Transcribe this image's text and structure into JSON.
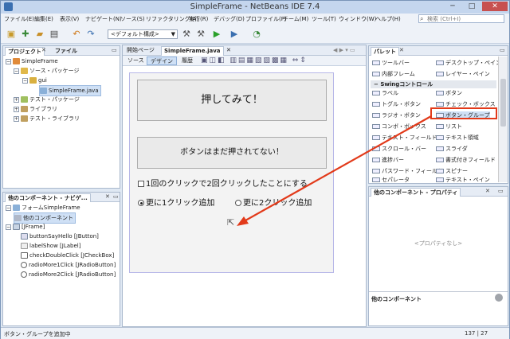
{
  "window": {
    "title": "SimpleFrame - NetBeans IDE 7.4"
  },
  "menu": [
    "ファイル(E)",
    "編集(E)",
    "表示(V)",
    "ナビゲート(N)",
    "ソース(S)",
    "リファクタリング(A)",
    "実行(R)",
    "デバッグ(D)",
    "プロファイル(P)",
    "チーム(M)",
    "ツール(T)",
    "ウィンドウ(W)",
    "ヘルプ(H)"
  ],
  "search": {
    "placeholder": "検索 (Ctrl+I)"
  },
  "toolbar": {
    "config": "<デフォルト構成>"
  },
  "project_panel": {
    "tabs": [
      "プロジェクト",
      "ファイル"
    ],
    "tree": [
      {
        "label": "SimpleFrame",
        "level": 0
      },
      {
        "label": "ソース・パッケージ",
        "level": 1
      },
      {
        "label": "gui",
        "level": 2
      },
      {
        "label": "SimpleFrame.java",
        "level": 3
      },
      {
        "label": "テスト・パッケージ",
        "level": 1
      },
      {
        "label": "ライブラリ",
        "level": 1
      },
      {
        "label": "テスト・ライブラリ",
        "level": 1
      }
    ]
  },
  "navigator_panel": {
    "title": "他のコンポーネント - ナビゲ...",
    "tree": [
      {
        "label": "フォームSimpleFrame",
        "level": 0
      },
      {
        "label": "他のコンポーネント",
        "level": 1
      },
      {
        "label": "[JFrame]",
        "level": 1
      },
      {
        "label": "buttonSayHello [JButton]",
        "level": 2
      },
      {
        "label": "labelShow [JLabel]",
        "level": 2
      },
      {
        "label": "checkDoubleClick [JCheckBox]",
        "level": 2
      },
      {
        "label": "radioMore1Click [JRadioButton]",
        "level": 2
      },
      {
        "label": "radioMore2Click [JRadioButton]",
        "level": 2
      }
    ]
  },
  "editor": {
    "tabs": [
      "開始ページ",
      "SimpleFrame.java"
    ],
    "subtabs": [
      "ソース",
      "デザイン",
      "履歴"
    ],
    "form": {
      "button_text": "押してみて！",
      "label_text": "ボタンはまだ押されてない！",
      "checkbox_text": "1回のクリックで2回クリックしたことにする",
      "radio1_text": "更に1クリック追加",
      "radio2_text": "更に2クリック追加"
    }
  },
  "palette": {
    "title": "パレット",
    "items_top": [
      "ツールバー",
      "デスクトップ・ペイン",
      "内部フレーム",
      "レイヤー・ペイン"
    ],
    "section": "Swingコントロール",
    "items": [
      "ラベル",
      "ボタン",
      "トグル・ボタン",
      "チェック・ボックス",
      "ラジオ・ボタン",
      "ボタン・グループ",
      "コンボ・ボックス",
      "リスト",
      "テキスト・フィールド",
      "テキスト領域",
      "スクロール・バー",
      "スライダ",
      "進捗バー",
      "書式付きフィールド",
      "パスワード・フィールド",
      "スピナー",
      "セパレータ",
      "テキスト・ペイン"
    ]
  },
  "properties_panel": {
    "title": "他のコンポーネント - プロパティ",
    "empty": "<プロパティなし>",
    "footer": "他のコンポーネント"
  },
  "status": {
    "text": "ボタン・グループを追加中",
    "position": "137 | 27"
  },
  "colors": {
    "accent": "#e23a1a",
    "selection": "#cfe0f5"
  }
}
